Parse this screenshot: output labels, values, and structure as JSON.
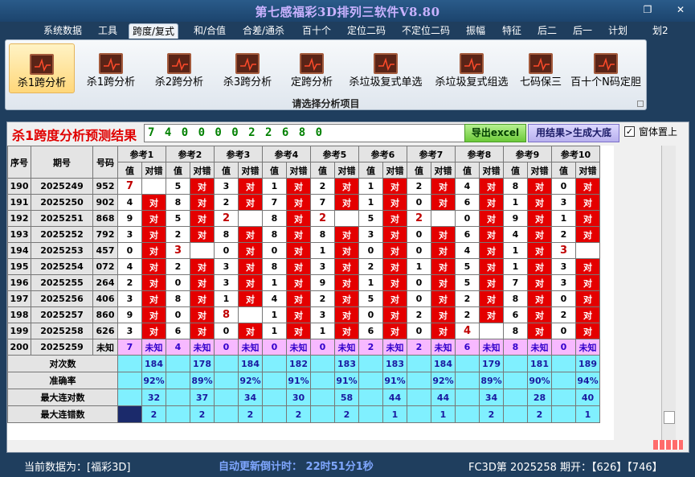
{
  "window": {
    "title": "第七感福彩3D排列三软件V8.80",
    "restore_glyph": "❐",
    "close_glyph": "✕"
  },
  "menu": [
    "系统数据",
    "工具",
    "跨度/复式",
    "和/合值",
    "合差/通杀",
    "百十个",
    "定位二码",
    "不定位二码",
    "振幅",
    "特征",
    "后二",
    "后一",
    "计划",
    "划2"
  ],
  "ribbon": {
    "buttons": [
      "杀1跨分析",
      "杀1跨分析",
      "杀2跨分析",
      "杀3跨分析",
      "定跨分析",
      "杀垃圾复式单选",
      "杀垃圾复式组选",
      "七码保三",
      "百十个N码定胆"
    ],
    "group_label": "请选择分析项目",
    "icon": "chart-icon"
  },
  "result": {
    "label": "杀1跨度分析预测结果",
    "value": "7 4 0 0 0 0 2 2 6 8 0",
    "export_button": "导出excel",
    "generate_button": "用结果>生成大底",
    "topmost_label": "窗体置上",
    "topmost_checked": true
  },
  "table": {
    "headers": {
      "index": "序号",
      "period": "期号",
      "number": "号码",
      "value": "值",
      "check": "对错"
    },
    "groups": [
      "参考1",
      "参考2",
      "参考3",
      "参考4",
      "参考5",
      "参考6",
      "参考7",
      "参考8",
      "参考9",
      "参考10"
    ],
    "hit_text": "对",
    "rows": [
      {
        "idx": "190",
        "period": "2025249",
        "num": "952",
        "cells": [
          [
            "7",
            ""
          ],
          [
            "5",
            "对"
          ],
          [
            "3",
            "对"
          ],
          [
            "1",
            "对"
          ],
          [
            "2",
            "对"
          ],
          [
            "1",
            "对"
          ],
          [
            "2",
            "对"
          ],
          [
            "4",
            "对"
          ],
          [
            "8",
            "对"
          ],
          [
            "0",
            "对"
          ]
        ]
      },
      {
        "idx": "191",
        "period": "2025250",
        "num": "902",
        "cells": [
          [
            "4",
            "对"
          ],
          [
            "8",
            "对"
          ],
          [
            "2",
            "对"
          ],
          [
            "7",
            "对"
          ],
          [
            "7",
            "对"
          ],
          [
            "1",
            "对"
          ],
          [
            "0",
            "对"
          ],
          [
            "6",
            "对"
          ],
          [
            "1",
            "对"
          ],
          [
            "3",
            "对"
          ]
        ]
      },
      {
        "idx": "192",
        "period": "2025251",
        "num": "868",
        "cells": [
          [
            "9",
            "对"
          ],
          [
            "5",
            "对"
          ],
          [
            "2",
            ""
          ],
          [
            "8",
            "对"
          ],
          [
            "2",
            ""
          ],
          [
            "5",
            "对"
          ],
          [
            "2",
            ""
          ],
          [
            "0",
            "对"
          ],
          [
            "9",
            "对"
          ],
          [
            "1",
            "对"
          ]
        ]
      },
      {
        "idx": "193",
        "period": "2025252",
        "num": "792",
        "cells": [
          [
            "3",
            "对"
          ],
          [
            "2",
            "对"
          ],
          [
            "8",
            "对"
          ],
          [
            "8",
            "对"
          ],
          [
            "8",
            "对"
          ],
          [
            "3",
            "对"
          ],
          [
            "0",
            "对"
          ],
          [
            "6",
            "对"
          ],
          [
            "4",
            "对"
          ],
          [
            "2",
            "对"
          ]
        ]
      },
      {
        "idx": "194",
        "period": "2025253",
        "num": "457",
        "cells": [
          [
            "0",
            "对"
          ],
          [
            "3",
            ""
          ],
          [
            "0",
            "对"
          ],
          [
            "0",
            "对"
          ],
          [
            "1",
            "对"
          ],
          [
            "0",
            "对"
          ],
          [
            "0",
            "对"
          ],
          [
            "4",
            "对"
          ],
          [
            "1",
            "对"
          ],
          [
            "3",
            ""
          ]
        ]
      },
      {
        "idx": "195",
        "period": "2025254",
        "num": "072",
        "cells": [
          [
            "4",
            "对"
          ],
          [
            "2",
            "对"
          ],
          [
            "3",
            "对"
          ],
          [
            "8",
            "对"
          ],
          [
            "3",
            "对"
          ],
          [
            "2",
            "对"
          ],
          [
            "1",
            "对"
          ],
          [
            "5",
            "对"
          ],
          [
            "1",
            "对"
          ],
          [
            "3",
            "对"
          ]
        ]
      },
      {
        "idx": "196",
        "period": "2025255",
        "num": "264",
        "cells": [
          [
            "2",
            "对"
          ],
          [
            "0",
            "对"
          ],
          [
            "3",
            "对"
          ],
          [
            "1",
            "对"
          ],
          [
            "9",
            "对"
          ],
          [
            "1",
            "对"
          ],
          [
            "0",
            "对"
          ],
          [
            "5",
            "对"
          ],
          [
            "7",
            "对"
          ],
          [
            "3",
            "对"
          ]
        ]
      },
      {
        "idx": "197",
        "period": "2025256",
        "num": "406",
        "cells": [
          [
            "3",
            "对"
          ],
          [
            "8",
            "对"
          ],
          [
            "1",
            "对"
          ],
          [
            "4",
            "对"
          ],
          [
            "2",
            "对"
          ],
          [
            "5",
            "对"
          ],
          [
            "0",
            "对"
          ],
          [
            "2",
            "对"
          ],
          [
            "8",
            "对"
          ],
          [
            "0",
            "对"
          ]
        ]
      },
      {
        "idx": "198",
        "period": "2025257",
        "num": "860",
        "cells": [
          [
            "9",
            "对"
          ],
          [
            "0",
            "对"
          ],
          [
            "8",
            ""
          ],
          [
            "1",
            "对"
          ],
          [
            "3",
            "对"
          ],
          [
            "0",
            "对"
          ],
          [
            "2",
            "对"
          ],
          [
            "2",
            "对"
          ],
          [
            "6",
            "对"
          ],
          [
            "2",
            "对"
          ]
        ]
      },
      {
        "idx": "199",
        "period": "2025258",
        "num": "626",
        "cells": [
          [
            "3",
            "对"
          ],
          [
            "6",
            "对"
          ],
          [
            "0",
            "对"
          ],
          [
            "1",
            "对"
          ],
          [
            "1",
            "对"
          ],
          [
            "6",
            "对"
          ],
          [
            "0",
            "对"
          ],
          [
            "4",
            ""
          ],
          [
            "8",
            "对"
          ],
          [
            "0",
            "对"
          ]
        ]
      }
    ],
    "future": {
      "idx": "200",
      "period": "2025259",
      "num": "未知",
      "values": [
        "7",
        "4",
        "0",
        "0",
        "0",
        "2",
        "2",
        "6",
        "8",
        "0"
      ],
      "unknown_text": "未知"
    },
    "stats": [
      {
        "label": "对次数",
        "values": [
          "184",
          "178",
          "184",
          "182",
          "183",
          "183",
          "184",
          "179",
          "181",
          "189"
        ]
      },
      {
        "label": "准确率",
        "values": [
          "92%",
          "89%",
          "92%",
          "91%",
          "91%",
          "91%",
          "92%",
          "89%",
          "90%",
          "94%"
        ]
      },
      {
        "label": "最大连对数",
        "values": [
          "32",
          "37",
          "34",
          "30",
          "58",
          "44",
          "44",
          "34",
          "28",
          "40"
        ]
      },
      {
        "label": "最大连错数",
        "values": [
          "2",
          "2",
          "2",
          "2",
          "2",
          "1",
          "1",
          "2",
          "2",
          "1"
        ]
      }
    ]
  },
  "status": {
    "current_data": "当前数据为：[福彩3D]",
    "countdown": "自动更新倒计时： 22时51分1秒",
    "draw_info": "FC3D第 2025258 期开：【626】【746】"
  }
}
